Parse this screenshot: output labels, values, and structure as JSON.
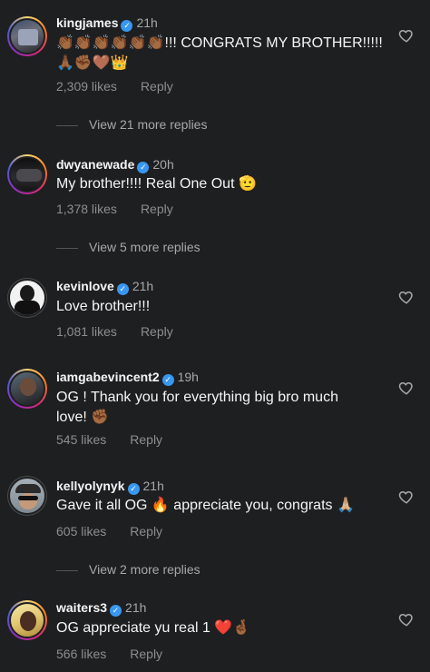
{
  "comments": [
    {
      "username": "kingjames",
      "verified": true,
      "time": "21h",
      "text": "👏🏾👏🏾👏🏾👏🏾👏🏾👏🏾!!! CONGRATS MY BROTHER!!!!! 🙏🏾✊🏾🤎👑",
      "likes": "2,309 likes",
      "reply": "Reply",
      "view_replies": "View 21 more replies"
    },
    {
      "username": "dwyanewade",
      "verified": true,
      "time": "20h",
      "text": "My brother!!!! Real One Out 🫡",
      "likes": "1,378 likes",
      "reply": "Reply",
      "view_replies": "View 5 more replies"
    },
    {
      "username": "kevinlove",
      "verified": true,
      "time": "21h",
      "text": "Love brother!!!",
      "likes": "1,081 likes",
      "reply": "Reply"
    },
    {
      "username": "iamgabevincent2",
      "verified": true,
      "time": "19h",
      "text": "OG ! Thank you for everything big bro much love! ✊🏾",
      "likes": "545 likes",
      "reply": "Reply"
    },
    {
      "username": "kellyolynyk",
      "verified": true,
      "time": "21h",
      "text": "Gave it all OG 🔥 appreciate you, congrats 🙏🏼",
      "likes": "605 likes",
      "reply": "Reply",
      "view_replies": "View 2 more replies"
    },
    {
      "username": "waiters3",
      "verified": true,
      "time": "21h",
      "text": "OG appreciate yu real 1 ❤️🤞🏾",
      "likes": "566 likes",
      "reply": "Reply"
    }
  ],
  "icons": {
    "verified": "verified-badge-icon",
    "like": "heart-outline-icon"
  },
  "colors": {
    "background": "#1e1f21",
    "verified": "#3897f0",
    "secondary_text": "#a8a8a8"
  }
}
